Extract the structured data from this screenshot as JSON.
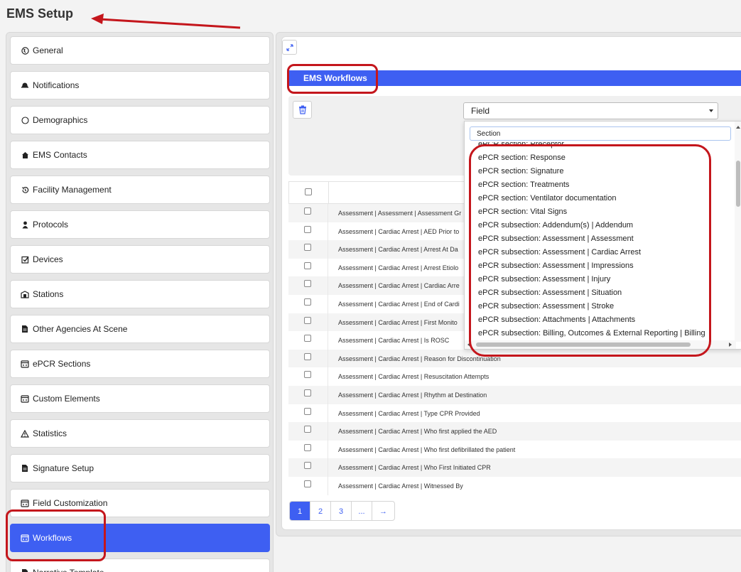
{
  "page_title": "EMS Setup",
  "sidebar": {
    "items": [
      {
        "label": "General",
        "icon": "globe-icon"
      },
      {
        "label": "Notifications",
        "icon": "bell-icon"
      },
      {
        "label": "Demographics",
        "icon": "circle-icon"
      },
      {
        "label": "EMS Contacts",
        "icon": "home-icon"
      },
      {
        "label": "Facility Management",
        "icon": "history-icon"
      },
      {
        "label": "Protocols",
        "icon": "user-icon"
      },
      {
        "label": "Devices",
        "icon": "checkbox-icon"
      },
      {
        "label": "Stations",
        "icon": "building-icon"
      },
      {
        "label": "Other Agencies At Scene",
        "icon": "document-icon"
      },
      {
        "label": "ePCR Sections",
        "icon": "window-icon"
      },
      {
        "label": "Custom Elements",
        "icon": "window-icon"
      },
      {
        "label": "Statistics",
        "icon": "warning-icon"
      },
      {
        "label": "Signature Setup",
        "icon": "document-icon"
      },
      {
        "label": "Field Customization",
        "icon": "window-icon"
      },
      {
        "label": "Workflows",
        "icon": "window-icon",
        "active": true
      },
      {
        "label": "Narrative Template",
        "icon": "document-icon"
      }
    ]
  },
  "main": {
    "header_title": "EMS Workflows",
    "select": {
      "value": "Field"
    },
    "dropdown": {
      "search_value": "Section",
      "options": [
        "ePCR section: Preceptor",
        "ePCR section: Response",
        "ePCR section: Signature",
        "ePCR section: Treatments",
        "ePCR section: Ventilator documentation",
        "ePCR section: Vital Signs",
        "ePCR subsection: Addendum(s) | Addendum",
        "ePCR subsection: Assessment | Assessment",
        "ePCR subsection: Assessment | Cardiac Arrest",
        "ePCR subsection: Assessment | Impressions",
        "ePCR subsection: Assessment | Injury",
        "ePCR subsection: Assessment | Situation",
        "ePCR subsection: Assessment | Stroke",
        "ePCR subsection: Attachments | Attachments",
        "ePCR subsection: Billing, Outcomes & External Reporting | Billing"
      ]
    },
    "table": {
      "rows": [
        "Assessment | Assessment | Assessment Gr",
        "Assessment | Cardiac Arrest | AED Prior to",
        "Assessment | Cardiac Arrest | Arrest At Da",
        "Assessment | Cardiac Arrest | Arrest Etiolo",
        "Assessment | Cardiac Arrest | Cardiac Arre",
        "Assessment | Cardiac Arrest | End of Cardi",
        "Assessment | Cardiac Arrest | First Monito",
        "Assessment | Cardiac Arrest | Is ROSC",
        "Assessment | Cardiac Arrest | Reason for Discontinuation",
        "Assessment | Cardiac Arrest | Resuscitation Attempts",
        "Assessment | Cardiac Arrest | Rhythm at Destination",
        "Assessment | Cardiac Arrest | Type CPR Provided",
        "Assessment | Cardiac Arrest | Who first applied the AED",
        "Assessment | Cardiac Arrest | Who first defibrillated the patient",
        "Assessment | Cardiac Arrest | Who First Initiated CPR",
        "Assessment | Cardiac Arrest | Witnessed By"
      ]
    },
    "pagination": {
      "pages": [
        "1",
        "2",
        "3",
        "...",
        "→"
      ],
      "current": "1"
    }
  },
  "colors": {
    "accent": "#3e5ff2",
    "annotation": "#c4161c"
  }
}
